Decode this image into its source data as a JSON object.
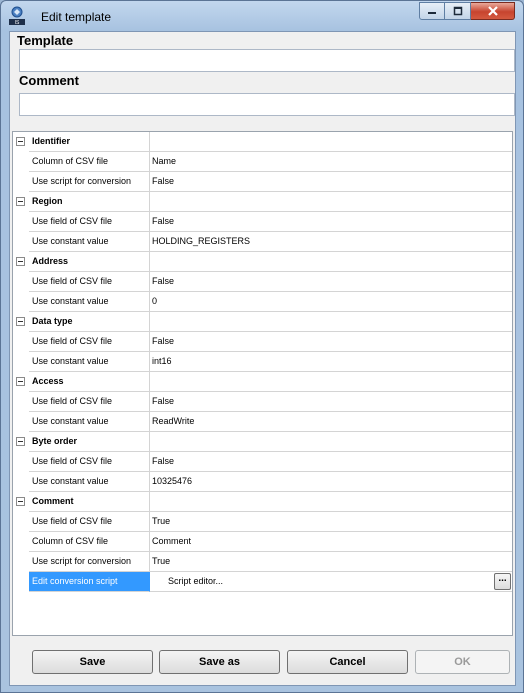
{
  "window": {
    "title": "Edit template"
  },
  "form": {
    "template_label": "Template",
    "template_value": "",
    "comment_label": "Comment",
    "comment_value": ""
  },
  "grid": {
    "rows": [
      {
        "type": "category",
        "name": "Identifier"
      },
      {
        "type": "prop",
        "name": "Column of CSV file",
        "value": "Name"
      },
      {
        "type": "prop",
        "name": "Use script for conversion",
        "value": "False"
      },
      {
        "type": "category",
        "name": "Region"
      },
      {
        "type": "prop",
        "name": "Use field of CSV file",
        "value": "False"
      },
      {
        "type": "prop",
        "name": "Use constant value",
        "value": "HOLDING_REGISTERS"
      },
      {
        "type": "category",
        "name": "Address"
      },
      {
        "type": "prop",
        "name": "Use field of CSV file",
        "value": "False"
      },
      {
        "type": "prop",
        "name": "Use constant value",
        "value": "0"
      },
      {
        "type": "category",
        "name": "Data type"
      },
      {
        "type": "prop",
        "name": "Use field of CSV file",
        "value": "False"
      },
      {
        "type": "prop",
        "name": "Use constant value",
        "value": "int16"
      },
      {
        "type": "category",
        "name": "Access"
      },
      {
        "type": "prop",
        "name": "Use field of CSV file",
        "value": "False"
      },
      {
        "type": "prop",
        "name": "Use constant value",
        "value": "ReadWrite"
      },
      {
        "type": "category",
        "name": "Byte order"
      },
      {
        "type": "prop",
        "name": "Use field of CSV file",
        "value": "False"
      },
      {
        "type": "prop",
        "name": "Use constant value",
        "value": "10325476"
      },
      {
        "type": "category",
        "name": "Comment"
      },
      {
        "type": "prop",
        "name": "Use field of CSV file",
        "value": "True"
      },
      {
        "type": "prop",
        "name": "Column of CSV file",
        "value": "Comment"
      },
      {
        "type": "prop",
        "name": "Use script for conversion",
        "value": "True"
      },
      {
        "type": "selected",
        "name": "Edit conversion script",
        "value": "Script editor...",
        "button": "..."
      }
    ]
  },
  "buttons": {
    "save": "Save",
    "save_as": "Save as",
    "cancel": "Cancel",
    "ok": "OK"
  },
  "colors": {
    "selection": "#3399ff",
    "close": "#c7442f"
  }
}
